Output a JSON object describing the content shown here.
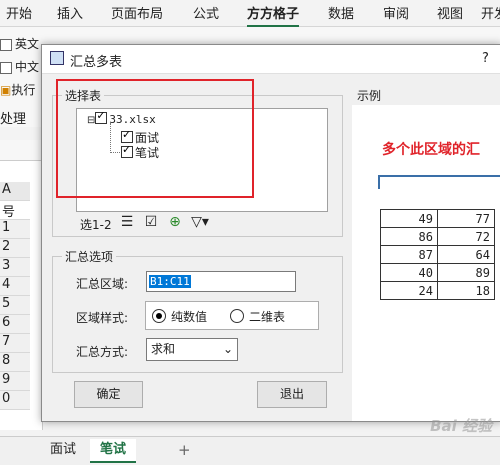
{
  "ribbon": {
    "tabs": [
      "开始",
      "插入",
      "页面布局",
      "公式",
      "方方格子",
      "数据",
      "审阅",
      "视图",
      "开发"
    ],
    "active_tab": "方方格子",
    "accent_color": "#217346",
    "items": [
      "英文",
      "中文",
      "执行"
    ],
    "group_label": "处理"
  },
  "sheet": {
    "column_header": "A",
    "first_cell": "号",
    "row_numbers": [
      "1",
      "2",
      "3",
      "4",
      "5",
      "6",
      "7",
      "8",
      "9",
      "0"
    ],
    "tabs": [
      "面试",
      "笔试"
    ],
    "active_tab": "笔试",
    "add_tab_symbol": "+"
  },
  "dialog": {
    "title": "汇总多表",
    "help": "?",
    "select_group_label": "选择表",
    "tree": {
      "file": "33.xlsx",
      "expand_symbol": "⊟",
      "sheets": [
        "面试",
        "笔试"
      ]
    },
    "selection_count": "选1-2",
    "summary_group_label": "汇总选项",
    "summary_area_label": "汇总区域:",
    "summary_area_value": "B1:C11",
    "area_style_label": "区域样式:",
    "area_style_options": [
      "纯数值",
      "二维表"
    ],
    "area_style_selected": "纯数值",
    "method_label": "汇总方式:",
    "method_value": "求和",
    "ok_label": "确定",
    "exit_label": "退出",
    "example_label": "示例"
  },
  "example": {
    "caption": "多个此区域的汇",
    "caption_color": "#e0232a",
    "rows": [
      [
        "49",
        "77"
      ],
      [
        "86",
        "72"
      ],
      [
        "87",
        "64"
      ],
      [
        "40",
        "89"
      ],
      [
        "24",
        "18"
      ]
    ]
  },
  "watermark": "Bai 经验"
}
